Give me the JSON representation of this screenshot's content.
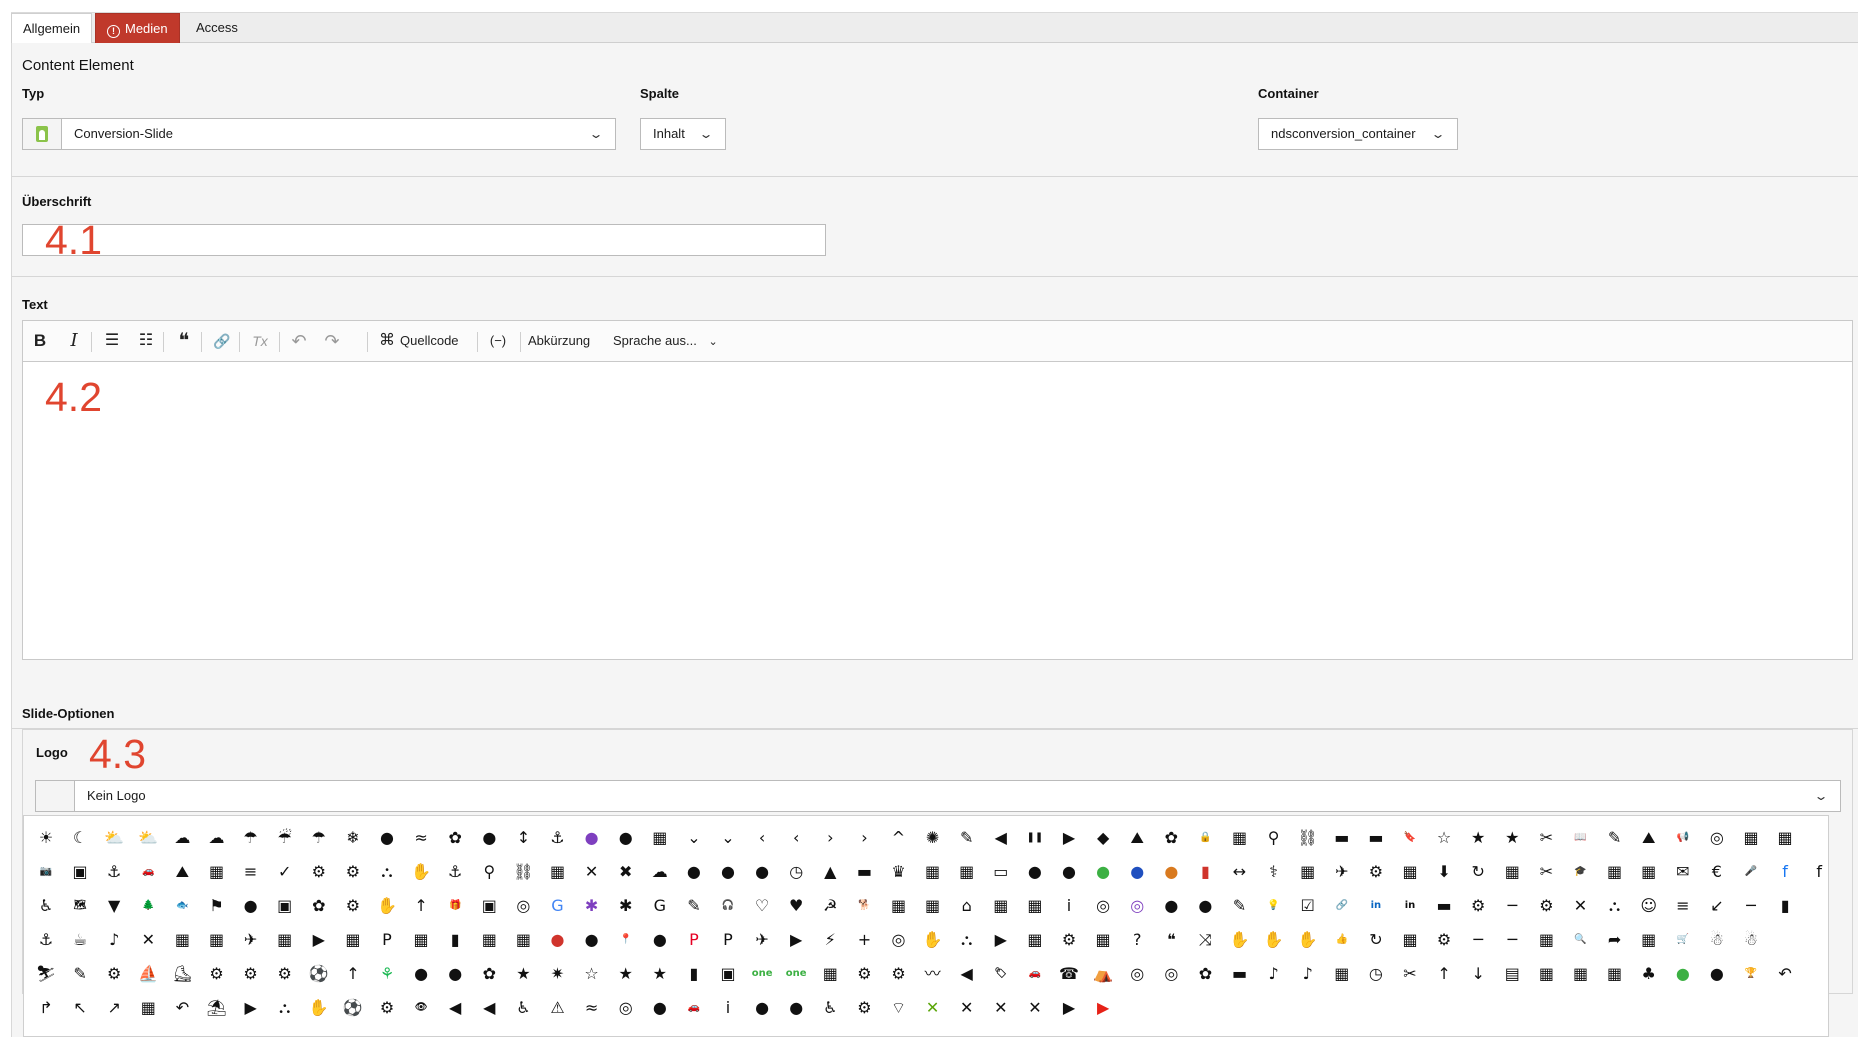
{
  "tabs": [
    {
      "label": "Allgemein",
      "state": "active"
    },
    {
      "label": "Medien",
      "state": "error"
    },
    {
      "label": "Access",
      "state": "normal"
    }
  ],
  "content_element": {
    "title": "Content Element",
    "typ": {
      "label": "Typ",
      "value": "Conversion-Slide"
    },
    "spalte": {
      "label": "Spalte",
      "value": "Inhalt"
    },
    "container": {
      "label": "Container",
      "value": "ndsconversion_container"
    }
  },
  "ueberschrift": {
    "label": "Überschrift",
    "value": "",
    "marker": "4.1"
  },
  "text": {
    "label": "Text",
    "marker": "4.2",
    "toolbar": {
      "bold": "B",
      "italic": "I",
      "bulleted_list": "☰",
      "numbered_list": "☷",
      "blockquote": "❝",
      "link": "🔗",
      "remove_format": "Tx",
      "undo": "↶",
      "redo": "↷",
      "source_label": "Quellcode",
      "soft_hyphen": "(−)",
      "abbreviation_label": "Abkürzung",
      "language_label": "Sprache aus..."
    }
  },
  "slide_options": {
    "title": "Slide-Optionen",
    "logo": {
      "label": "Logo",
      "marker": "4.3",
      "value": "Kein Logo"
    }
  },
  "icon_grid": {
    "colors": {
      "default": "#111111",
      "accent": "#7e3fbf",
      "google": "#4285f4",
      "green": "#3cb043",
      "blue": "#1f4fbf",
      "orange": "#d97a1f",
      "red": "#d0342c",
      "facebook": "#1877f2",
      "linkedin": "#0a66c2",
      "spotify": "#1db954",
      "whatsapp": "#25d366",
      "youtube": "#e62117",
      "pinterest": "#e60023",
      "xing": "#5ba60a"
    },
    "rows": [
      [
        "☀",
        "☾",
        "⛅",
        "⛅",
        "☁",
        "☁",
        "☂",
        "☔",
        "☂",
        "❄",
        "●",
        "≈",
        "✿",
        "●",
        "↕",
        "⚓",
        "●",
        "●",
        "▦",
        "⌄",
        "⌄",
        "‹",
        "‹",
        "›",
        "›",
        "^",
        "✺",
        "✎",
        "◀",
        "❚❚",
        "▶",
        "◆",
        "⛰",
        "✿",
        "🔒",
        "▦",
        "⚲",
        "⛓",
        "▬",
        "▬",
        "🔖",
        "☆",
        "★",
        "★",
        "✂",
        "📖",
        "✎",
        "⛰",
        "📢",
        "◎",
        "▦",
        "▦"
      ],
      [
        "📷",
        "▣",
        "⚓",
        "🚗",
        "⛰",
        "▦",
        "≡",
        "✓",
        "⚙",
        "⚙",
        "⛬",
        "✋",
        "⚓",
        "⚲",
        "⛓",
        "▦",
        "✕",
        "✖",
        "☁",
        "●",
        "●",
        "●",
        "◷",
        "▲",
        "▬",
        "♛",
        "▦",
        "▦",
        "▭",
        "●",
        "●",
        "●",
        "●",
        "●",
        "▮",
        "↔",
        "⚕",
        "▦",
        "✈",
        "⚙",
        "▦",
        "⬇",
        "↻",
        "▦",
        "✂",
        "🎓",
        "▦",
        "▦",
        "✉",
        "€",
        "🎤",
        "f",
        "f"
      ],
      [
        "♿",
        "🗺",
        "▼",
        "🌲",
        "🐟",
        "⚑",
        "●",
        "▣",
        "✿",
        "⚙",
        "✋",
        "↑",
        "🎁",
        "▣",
        "◎",
        "G",
        "✱",
        "✱",
        "G",
        "✎",
        "🎧",
        "♡",
        "♥",
        "☭",
        "🐕",
        "▦",
        "▦",
        "⌂",
        "▦",
        "▦",
        "i",
        "◎",
        "◎",
        "●",
        "●",
        "✎",
        "💡",
        "☑",
        "🔗",
        "in",
        "in",
        "▬",
        "⚙",
        "─",
        "⚙",
        "✕",
        "⛬",
        "☺",
        "≡",
        "↙",
        "─",
        "▮"
      ],
      [
        "⚓",
        "☕",
        "♪",
        "✕",
        "▦",
        "▦",
        "✈",
        "▦",
        "▶",
        "▦",
        "P",
        "▦",
        "▮",
        "▦",
        "▦",
        "●",
        "●",
        "📍",
        "●",
        "P",
        "P",
        "✈",
        "▶",
        "⚡",
        "+",
        "◎",
        "✋",
        "⛬",
        "▶",
        "▦",
        "⚙",
        "▦",
        "?",
        "❝",
        "⤨",
        "✋",
        "✋",
        "✋",
        "👍",
        "↻",
        "▦",
        "⚙",
        "─",
        "─",
        "▦",
        "🔍",
        "➦",
        "▦",
        "🛒",
        "☃",
        "☃"
      ],
      [
        "⛷",
        "✎",
        "⚙",
        "⛵",
        "⛸",
        "⚙",
        "⚙",
        "⚙",
        "⚽",
        "↑",
        "⚘",
        "●",
        "●",
        "✿",
        "★",
        "✷",
        "☆",
        "★",
        "★",
        "▮",
        "▣",
        "one",
        "one",
        "▦",
        "⚙",
        "⚙",
        "〰",
        "◀",
        "🏷",
        "🚗",
        "☎",
        "⛺",
        "◎",
        "◎",
        "✿",
        "▬",
        "♪",
        "♪",
        "▦",
        "◷",
        "✂",
        "↑",
        "↓",
        "▤",
        "▦",
        "▦",
        "▦",
        "♣",
        "●",
        "●",
        "🏆",
        "↶"
      ],
      [
        "↱",
        "↖",
        "↗",
        "▦",
        "↶",
        "⛱",
        "▶",
        "⛬",
        "✋",
        "⚽",
        "⚙",
        "👁",
        "◀",
        "◀",
        "♿",
        "⚠",
        "≈",
        "◎",
        "●",
        "🚗",
        "i",
        "●",
        "●",
        "♿",
        "⚙",
        "⌔",
        "✕",
        "✕",
        "✕",
        "✕",
        "▶",
        "▶"
      ]
    ]
  }
}
